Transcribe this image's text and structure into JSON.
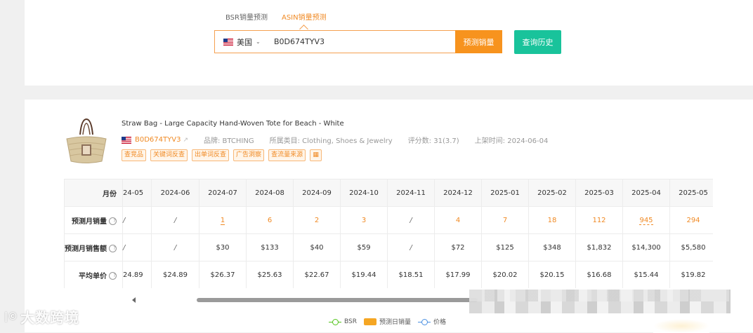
{
  "tabs": [
    {
      "label": "BSR销量预测",
      "active": false
    },
    {
      "label": "ASIN销量预测",
      "active": true
    }
  ],
  "search": {
    "country": "美国",
    "asin_value": "B0D674TYV3",
    "predict_label": "预测销量",
    "history_label": "查询历史"
  },
  "product": {
    "title": "Straw Bag - Large Capacity Hand-Woven Tote for Beach - White",
    "asin": "B0D674TYV3",
    "brand": "品牌: BTCHING",
    "category": "所属类目: Clothing, Shoes & Jewelry",
    "rating": "评分数: 31(3.7)",
    "launch": "上架时间: 2024-06-04",
    "tags": [
      "查竞品",
      "关键词反查",
      "出单词反查",
      "广告洞察",
      "查流量来源"
    ],
    "calc_icon": "calculator-icon"
  },
  "table": {
    "row_labels": {
      "month": "月份",
      "sales": "预测月销量",
      "revenue": "预测月销售额",
      "price": "平均单价"
    },
    "months": [
      "24-05",
      "2024-06",
      "2024-07",
      "2024-08",
      "2024-09",
      "2024-10",
      "2024-11",
      "2024-12",
      "2025-01",
      "2025-02",
      "2025-03",
      "2025-04",
      "2025-05"
    ],
    "sales": [
      "/",
      "/",
      "1",
      "6",
      "2",
      "3",
      "/",
      "4",
      "7",
      "18",
      "112",
      "945",
      "294"
    ],
    "revenue": [
      "/",
      "/",
      "$30",
      "$133",
      "$40",
      "$59",
      "/",
      "$72",
      "$125",
      "$348",
      "$1,832",
      "$14,300",
      "$5,580"
    ],
    "price": [
      "24.89",
      "$24.89",
      "$26.37",
      "$25.63",
      "$22.67",
      "$19.44",
      "$18.51",
      "$17.99",
      "$20.02",
      "$20.15",
      "$16.68",
      "$15.44",
      "$19.82"
    ]
  },
  "legend": [
    {
      "label": "BSR",
      "color": "#52c41a"
    },
    {
      "label": "预测日销量",
      "color": "#f5a623"
    },
    {
      "label": "价格",
      "color": "#4a90e2"
    }
  ],
  "watermark": {
    "logo": "|©",
    "text": "大数跨境"
  },
  "colors": {
    "accent": "#f7931e",
    "teal": "#19c39b"
  }
}
